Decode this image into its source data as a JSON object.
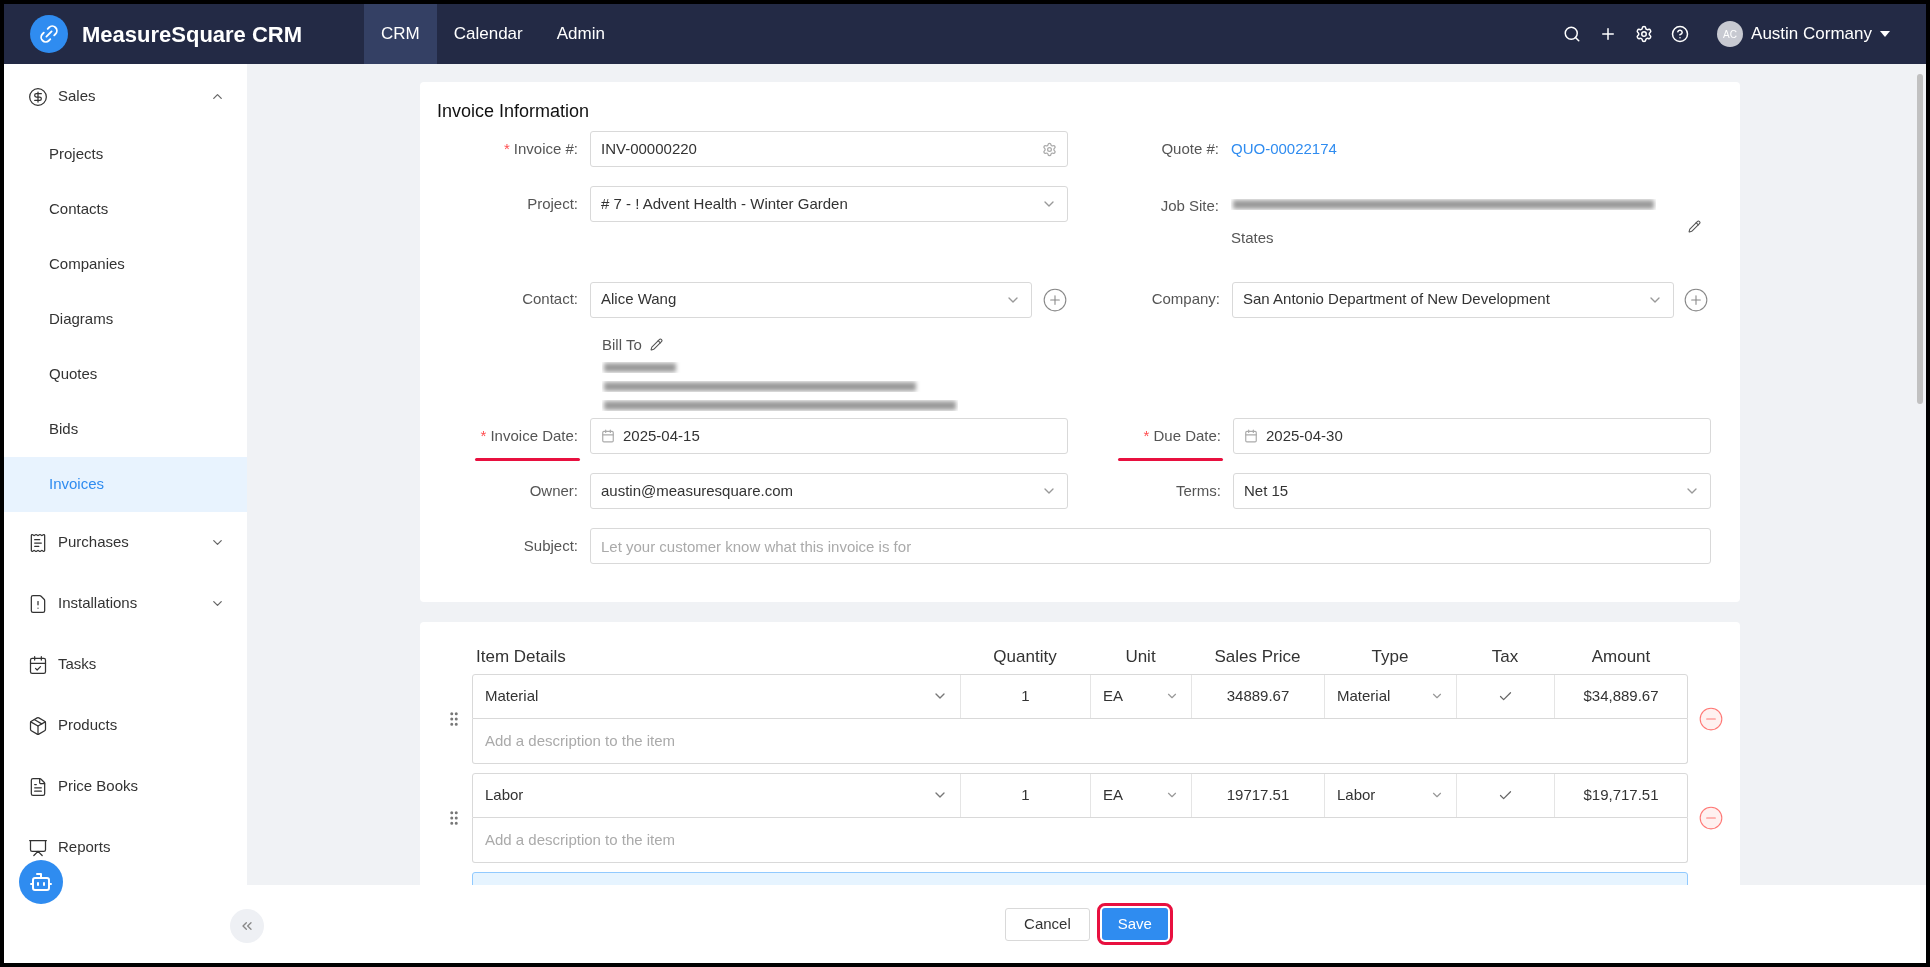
{
  "app": {
    "name": "MeasureSquare CRM"
  },
  "nav": [
    {
      "label": "CRM",
      "selected": true
    },
    {
      "label": "Calendar",
      "selected": false
    },
    {
      "label": "Admin",
      "selected": false
    }
  ],
  "user": {
    "initials": "AC",
    "name": "Austin Cormany"
  },
  "sidebar": {
    "items": [
      {
        "label": "Sales",
        "expanded": true,
        "selected": false,
        "children": [
          {
            "label": "Projects",
            "selected": false
          },
          {
            "label": "Contacts",
            "selected": false
          },
          {
            "label": "Companies",
            "selected": false
          },
          {
            "label": "Diagrams",
            "selected": false
          },
          {
            "label": "Quotes",
            "selected": false
          },
          {
            "label": "Bids",
            "selected": false
          },
          {
            "label": "Invoices",
            "selected": true
          }
        ]
      },
      {
        "label": "Purchases",
        "expanded": false,
        "selected": false
      },
      {
        "label": "Installations",
        "expanded": false,
        "selected": false
      },
      {
        "label": "Tasks",
        "selected": false
      },
      {
        "label": "Products",
        "selected": false
      },
      {
        "label": "Price Books",
        "selected": false
      },
      {
        "label": "Reports",
        "selected": false
      }
    ]
  },
  "invoice_info": {
    "title": "Invoice Information",
    "required_mark": "*",
    "invoice_no": {
      "label": "Invoice #:",
      "required": true,
      "value": "INV-00000220"
    },
    "quote": {
      "label": "Quote #:",
      "value": "QUO-00022174"
    },
    "project": {
      "label": "Project:",
      "required": false,
      "value": "# 7 - ! Advent Health - Winter Garden"
    },
    "job_site": {
      "label": "Job Site:",
      "value": "States"
    },
    "contact": {
      "label": "Contact:",
      "required": false,
      "value": "Alice Wang"
    },
    "company": {
      "label": "Company:",
      "required": false,
      "value": "San Antonio Department of New Development"
    },
    "bill_to": {
      "label": "Bill To"
    },
    "invoice_date": {
      "label": "Invoice Date:",
      "required": true,
      "underlined": true,
      "value": "2025-04-15"
    },
    "due_date": {
      "label": "Due Date:",
      "required": true,
      "underlined": true,
      "value": "2025-04-30"
    },
    "owner": {
      "label": "Owner:",
      "required": false,
      "value": "austin@measuresquare.com"
    },
    "terms": {
      "label": "Terms:",
      "required": false,
      "value": "Net 15"
    },
    "subject": {
      "label": "Subject:",
      "required": false,
      "placeholder": "Let your customer know what this invoice is for"
    }
  },
  "items": {
    "columns": [
      "Item Details",
      "Quantity",
      "Unit",
      "Sales Price",
      "Type",
      "Tax",
      "Amount"
    ],
    "rows": [
      {
        "item": "Material",
        "quantity": "1",
        "unit": "EA",
        "price": "34889.67",
        "type": "Material",
        "tax": true,
        "amount": "$34,889.67",
        "description_placeholder": "Add a description to the item"
      },
      {
        "item": "Labor",
        "quantity": "1",
        "unit": "EA",
        "price": "19717.51",
        "type": "Labor",
        "tax": true,
        "amount": "$19,717.51",
        "description_placeholder": "Add a description to the item"
      }
    ]
  },
  "footer": {
    "buttons": [
      "Cancel",
      "Save"
    ]
  }
}
